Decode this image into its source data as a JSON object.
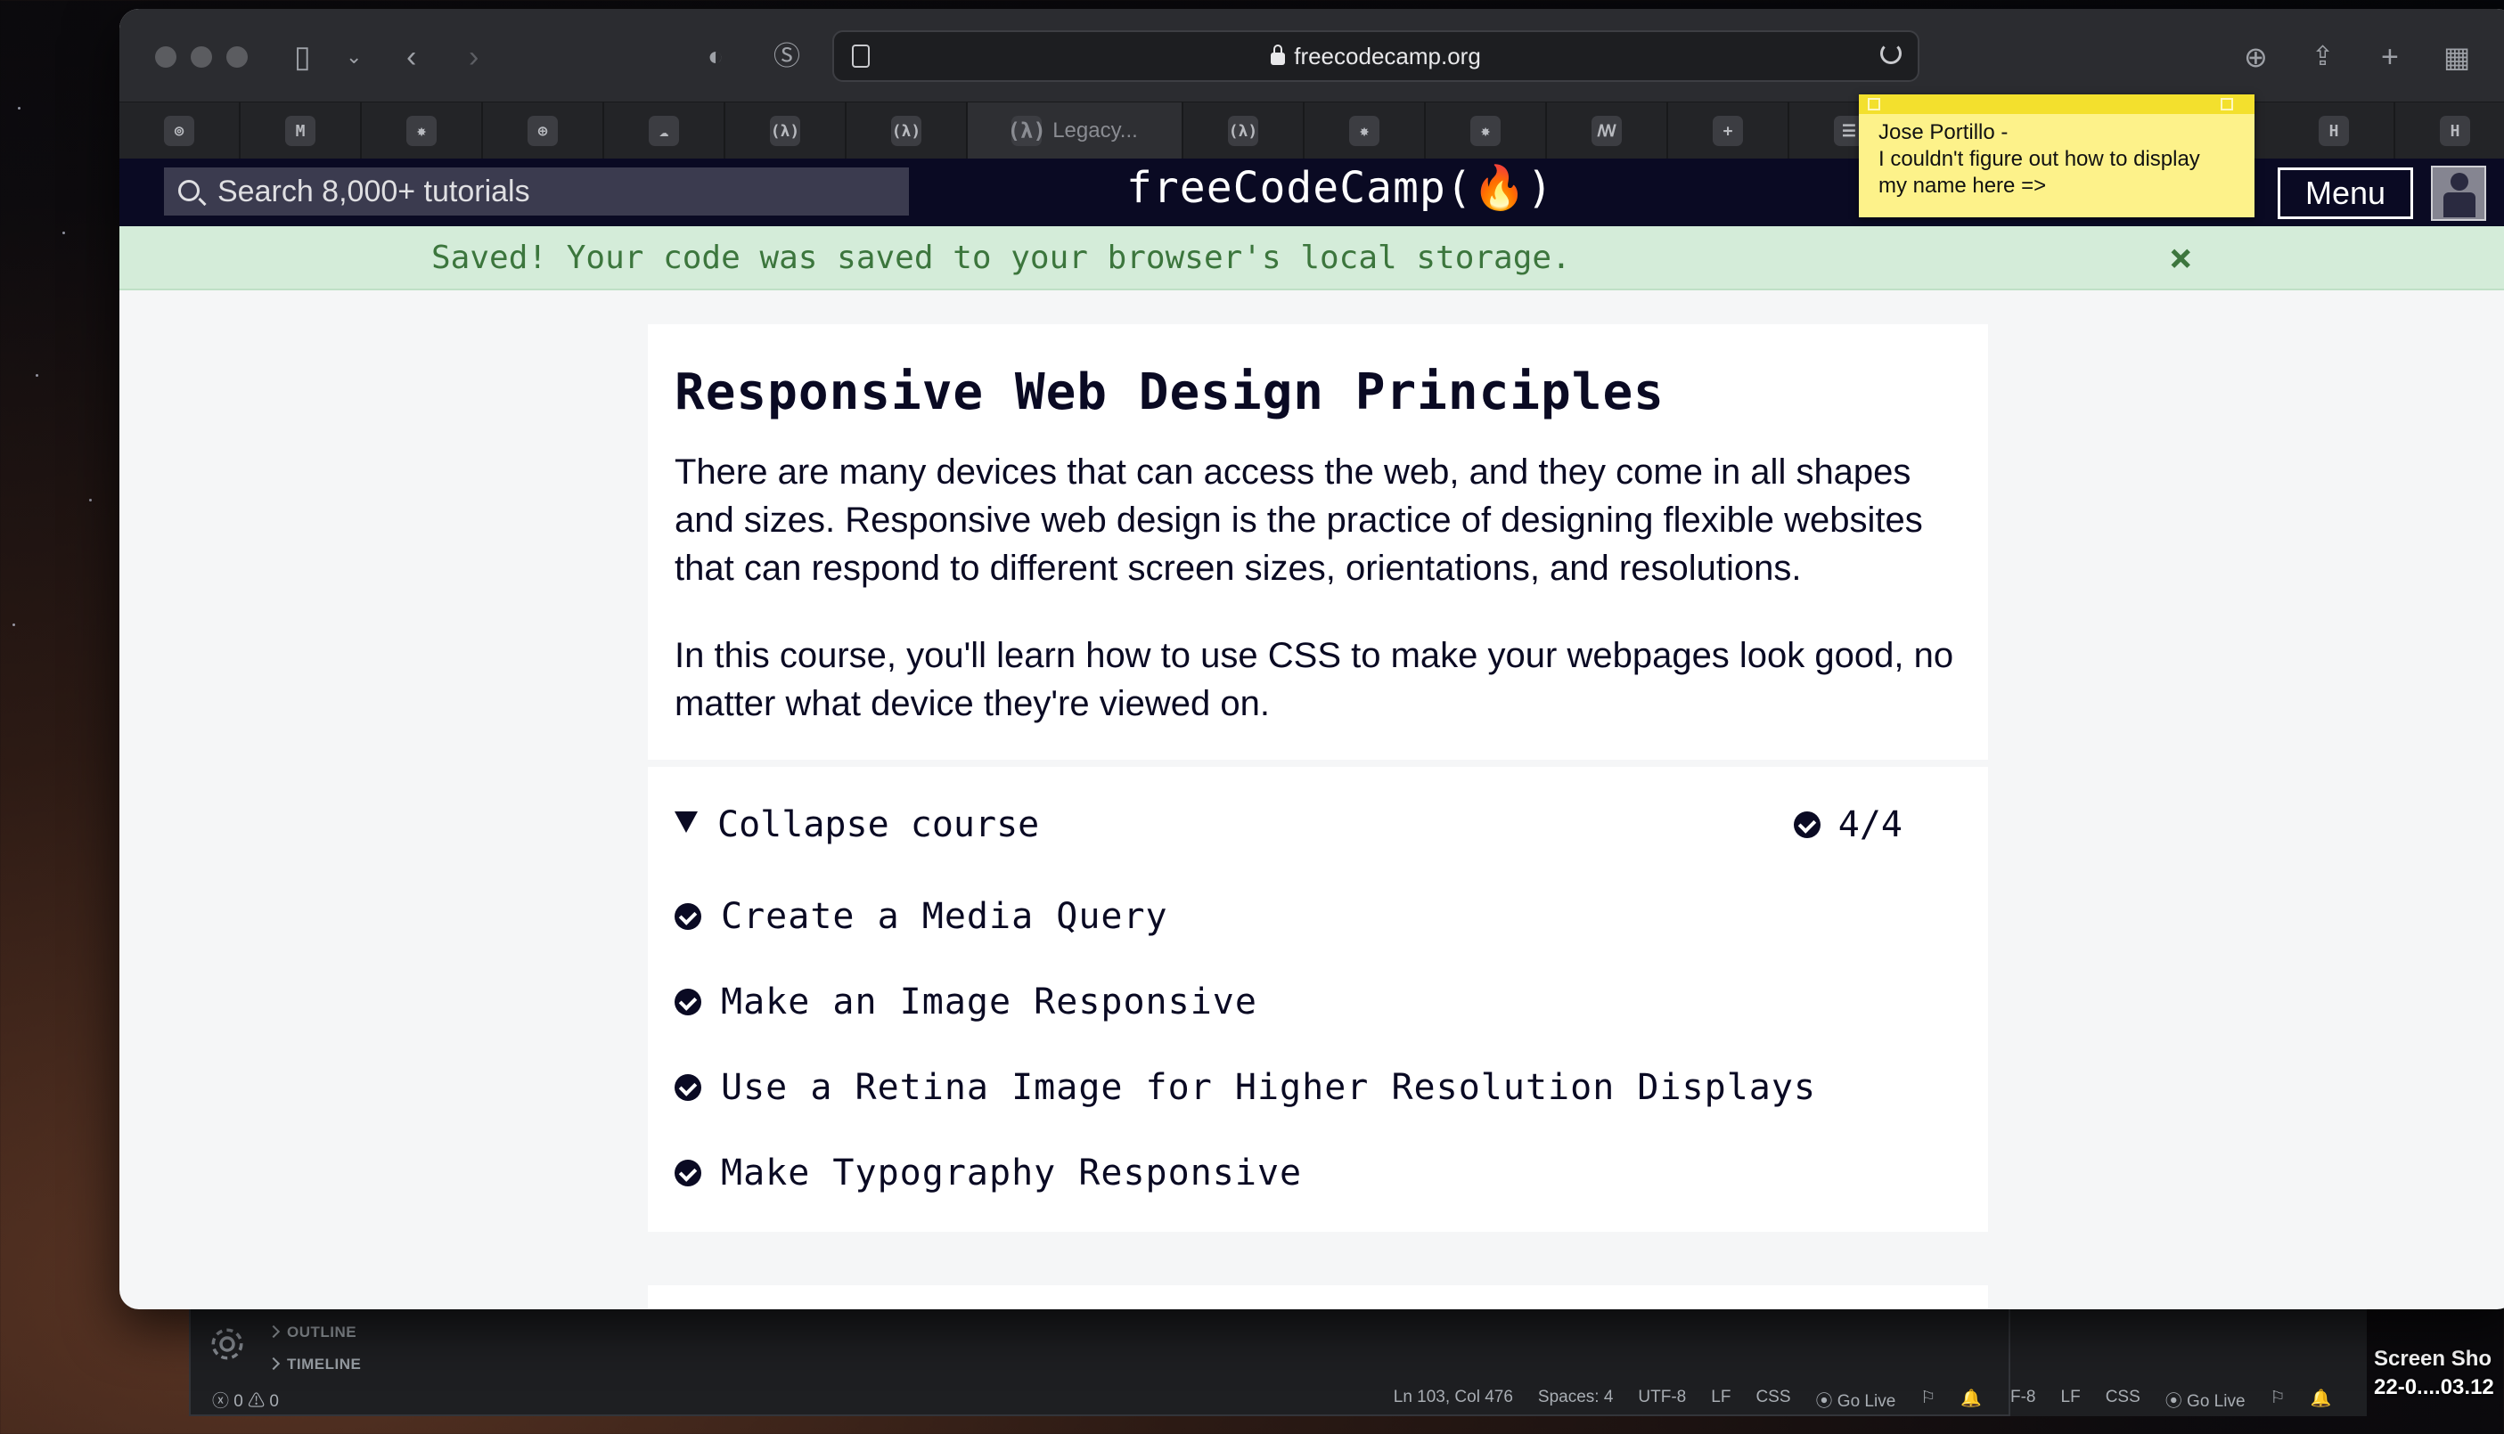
{
  "browser": {
    "url": "freecodecamp.org",
    "tabs": [
      {
        "icon": "⊚"
      },
      {
        "icon": "M"
      },
      {
        "icon": "✸"
      },
      {
        "icon": "⊕"
      },
      {
        "icon": "☁"
      },
      {
        "icon": "(λ)"
      },
      {
        "icon": "(λ)"
      },
      {
        "icon": "(λ)",
        "label": "Legacy..."
      },
      {
        "icon": "(λ)"
      },
      {
        "icon": "✸"
      },
      {
        "icon": "✸"
      },
      {
        "icon": "ꟿ"
      },
      {
        "icon": "+"
      },
      {
        "icon": "☰"
      },
      {
        "icon": "H"
      },
      {
        "icon": "H"
      }
    ]
  },
  "fcc": {
    "search_placeholder": "Search 8,000+ tutorials",
    "logo": "freeCodeCamp(🔥)",
    "menu_label": "Menu"
  },
  "sticky_note": {
    "line1": "Jose Portillo -",
    "line2": "I couldn't figure out how to display",
    "line3": "my name here =>"
  },
  "banner": {
    "message": "Saved! Your code was saved to your browser's local storage.",
    "close": "×"
  },
  "course": {
    "title": "Responsive Web Design Principles",
    "paragraph1": "There are many devices that can access the web, and they come in all shapes and sizes. Responsive web design is the practice of designing flexible websites that can respond to different screen sizes, orientations, and resolutions.",
    "paragraph2": "In this course, you'll learn how to use CSS to make your webpages look good, no matter what device they're viewed on.",
    "collapse_label": "Collapse course",
    "progress": "4/4",
    "lessons": [
      "Create a Media Query",
      "Make an Image Responsive",
      "Use a Retina Image for Higher Resolution Displays",
      "Make Typography Responsive"
    ]
  },
  "vscode": {
    "outline": "OUTLINE",
    "timeline": "TIMELINE",
    "problems": "ⓧ 0 ⚠ 0",
    "status": [
      "Ln 103, Col 476",
      "Spaces: 4",
      "UTF-8",
      "LF",
      "CSS",
      "⦿ Go Live",
      "⚐",
      "🔔"
    ],
    "status2": [
      "F-8",
      "LF",
      "CSS",
      "⦿ Go Live",
      "⚐",
      "🔔"
    ]
  },
  "desktop": {
    "label1": "Screen Sho",
    "label2": "22-0....03.12"
  }
}
